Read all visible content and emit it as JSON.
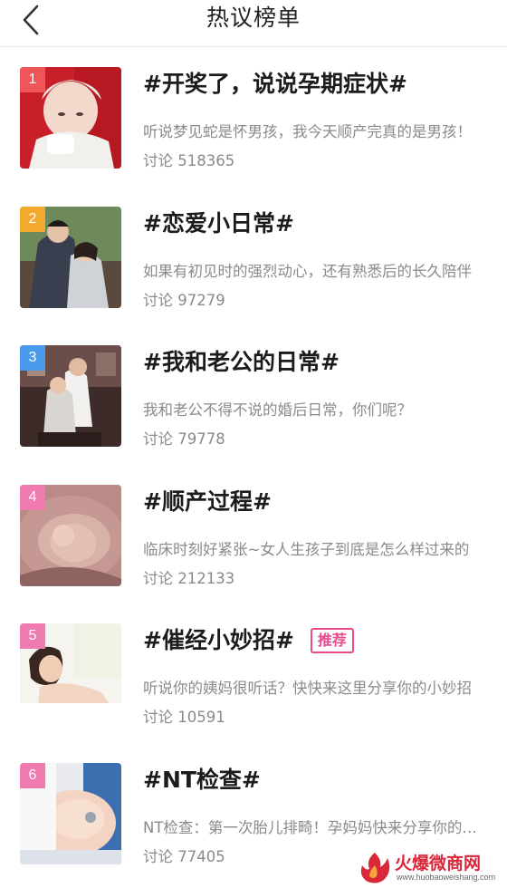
{
  "header": {
    "title": "热议榜单",
    "back_icon": "chevron-left-icon"
  },
  "rank_colors": [
    "#f0555a",
    "#f3a82e",
    "#4a9bee",
    "#f07bb0",
    "#f07bb0",
    "#f07bb0"
  ],
  "topics": [
    {
      "rank": "1",
      "title": "#开奖了，说说孕期症状#",
      "desc": "听说梦见蛇是怀男孩，我今天顺产完真的是男孩！",
      "count": "讨论 518365"
    },
    {
      "rank": "2",
      "title": "#恋爱小日常#",
      "desc": "如果有初见时的强烈动心，还有熟悉后的长久陪伴",
      "count": "讨论 97279"
    },
    {
      "rank": "3",
      "title": "#我和老公的日常#",
      "desc": "我和老公不得不说的婚后日常，你们呢？",
      "count": "讨论 79778"
    },
    {
      "rank": "4",
      "title": "#顺产过程#",
      "desc": "临床时刻好紧张~女人生孩子到底是怎么样过来的",
      "count": "讨论 212133"
    },
    {
      "rank": "5",
      "title": "#催经小妙招#",
      "badge": "推荐",
      "desc": "听说你的姨妈很听话？快快来这里分享你的小妙招",
      "count": "讨论 10591"
    },
    {
      "rank": "6",
      "title": "#NT检查#",
      "desc": "NT检查：第一次胎儿排畸！孕妈妈快来分享你的经历",
      "count": "讨论 77405"
    }
  ],
  "watermark": {
    "text": "火爆微商网",
    "url": "www.huobaoweishang.com"
  }
}
